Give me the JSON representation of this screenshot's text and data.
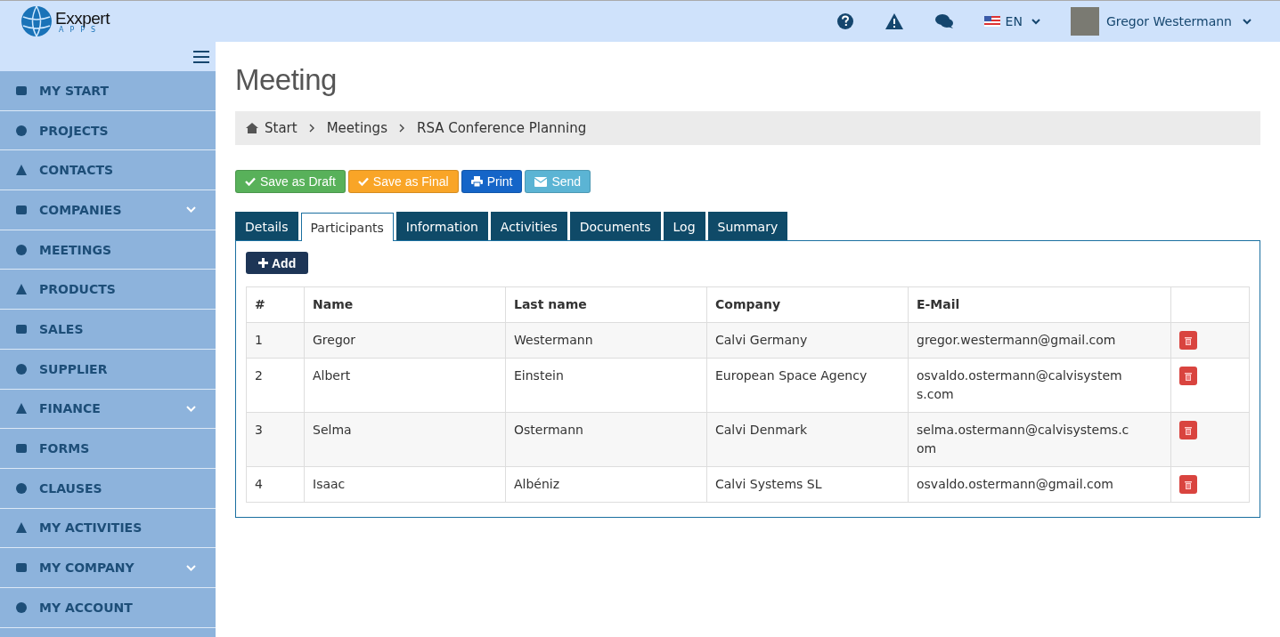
{
  "header": {
    "logo_title": "Exxpert",
    "logo_subtitle": "APPS",
    "language": "EN",
    "user_name": "Gregor Westermann"
  },
  "sidebar": {
    "items": [
      {
        "label": "MY START",
        "expandable": false
      },
      {
        "label": "PROJECTS",
        "expandable": false
      },
      {
        "label": "CONTACTS",
        "expandable": false
      },
      {
        "label": "COMPANIES",
        "expandable": true
      },
      {
        "label": "MEETINGS",
        "expandable": false
      },
      {
        "label": "PRODUCTS",
        "expandable": false
      },
      {
        "label": "SALES",
        "expandable": false
      },
      {
        "label": "SUPPLIER",
        "expandable": false
      },
      {
        "label": "FINANCE",
        "expandable": true
      },
      {
        "label": "FORMS",
        "expandable": false
      },
      {
        "label": "CLAUSES",
        "expandable": false
      },
      {
        "label": "MY ACTIVITIES",
        "expandable": false
      },
      {
        "label": "MY COMPANY",
        "expandable": true
      },
      {
        "label": "MY ACCOUNT",
        "expandable": false
      }
    ]
  },
  "page": {
    "title": "Meeting",
    "breadcrumb": [
      "Start",
      "Meetings",
      "RSA Conference Planning"
    ],
    "actions": [
      {
        "label": "Save as Draft",
        "kind": "draft"
      },
      {
        "label": "Save as Final",
        "kind": "final"
      },
      {
        "label": "Print",
        "kind": "print"
      },
      {
        "label": "Send",
        "kind": "send"
      }
    ],
    "tabs": [
      {
        "label": "Details",
        "selected": false
      },
      {
        "label": "Participants",
        "selected": true
      },
      {
        "label": "Information",
        "selected": false
      },
      {
        "label": "Activities",
        "selected": false
      },
      {
        "label": "Documents",
        "selected": false
      },
      {
        "label": "Log",
        "selected": false
      },
      {
        "label": "Summary",
        "selected": false
      }
    ],
    "add_button": "Add",
    "table": {
      "columns": [
        "#",
        "Name",
        "Last name",
        "Company",
        "E-Mail"
      ],
      "rows": [
        [
          "1",
          "Gregor",
          "Westermann",
          "Calvi Germany",
          "gregor.westermann@gmail.com"
        ],
        [
          "2",
          "Albert",
          "Einstein",
          "European Space Agency",
          "osvaldo.ostermann@calvisystems.com"
        ],
        [
          "3",
          "Selma",
          "Ostermann",
          "Calvi Denmark",
          "selma.ostermann@calvisystems.com"
        ],
        [
          "4",
          "Isaac",
          "Albéniz",
          "Calvi Systems SL",
          "osvaldo.ostermann@gmail.com"
        ]
      ]
    }
  }
}
